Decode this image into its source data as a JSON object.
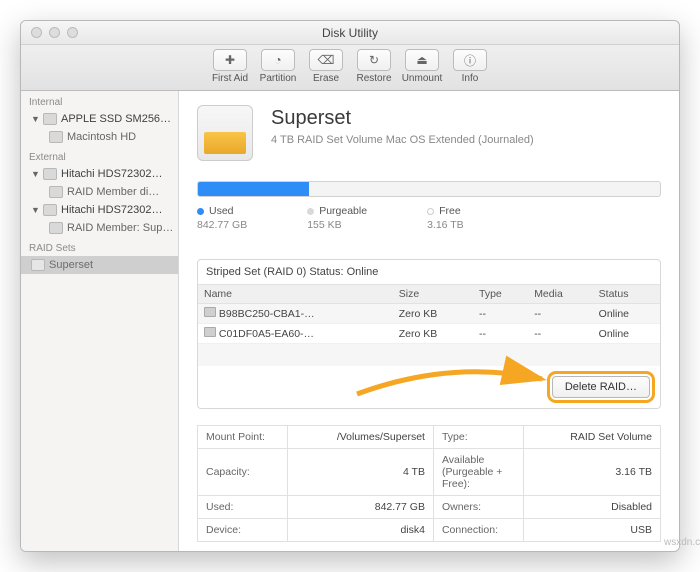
{
  "window": {
    "title": "Disk Utility"
  },
  "toolbar": [
    {
      "icon": "✚",
      "label": "First Aid"
    },
    {
      "icon": "◔",
      "label": "Partition"
    },
    {
      "icon": "⌫",
      "label": "Erase"
    },
    {
      "icon": "↻",
      "label": "Restore"
    },
    {
      "icon": "⏏",
      "label": "Unmount"
    },
    {
      "icon": "ⓘ",
      "label": "Info"
    }
  ],
  "sidebar": {
    "sections": [
      {
        "title": "Internal",
        "items": [
          {
            "label": "APPLE SSD SM256…",
            "expandable": true,
            "children": [
              {
                "label": "Macintosh HD"
              }
            ]
          }
        ]
      },
      {
        "title": "External",
        "items": [
          {
            "label": "Hitachi HDS72302…",
            "expandable": true,
            "children": [
              {
                "label": "RAID Member di…"
              }
            ]
          },
          {
            "label": "Hitachi HDS72302…",
            "expandable": true,
            "children": [
              {
                "label": "RAID Member: Sup…"
              }
            ]
          }
        ]
      },
      {
        "title": "RAID Sets",
        "items": [
          {
            "label": "Superset",
            "selected": true
          }
        ]
      }
    ]
  },
  "volume": {
    "name": "Superset",
    "subtitle": "4 TB RAID Set Volume Mac OS Extended (Journaled)",
    "usage_percent": 24,
    "legend": {
      "used": {
        "label": "Used",
        "value": "842.77 GB",
        "color": "#2e8df6"
      },
      "purgeable": {
        "label": "Purgeable",
        "value": "155 KB",
        "color": "#d9d9d9"
      },
      "free": {
        "label": "Free",
        "value": "3.16 TB",
        "color": "#f0f0f0"
      }
    }
  },
  "raid": {
    "title": "Striped Set (RAID 0) Status: Online",
    "columns": [
      "Name",
      "Size",
      "Type",
      "Media",
      "Status"
    ],
    "rows": [
      {
        "name": "B98BC250-CBA1-…",
        "size": "Zero KB",
        "type": "--",
        "media": "--",
        "status": "Online"
      },
      {
        "name": "C01DF0A5-EA60-…",
        "size": "Zero KB",
        "type": "--",
        "media": "--",
        "status": "Online"
      }
    ],
    "delete_label": "Delete RAID…"
  },
  "info": [
    {
      "k": "Mount Point:",
      "v": "/Volumes/Superset",
      "k2": "Type:",
      "v2": "RAID Set Volume"
    },
    {
      "k": "Capacity:",
      "v": "4 TB",
      "k2": "Available (Purgeable + Free):",
      "v2": "3.16 TB"
    },
    {
      "k": "Used:",
      "v": "842.77 GB",
      "k2": "Owners:",
      "v2": "Disabled"
    },
    {
      "k": "Device:",
      "v": "disk4",
      "k2": "Connection:",
      "v2": "USB"
    }
  ],
  "watermark": "wsxdn.com"
}
